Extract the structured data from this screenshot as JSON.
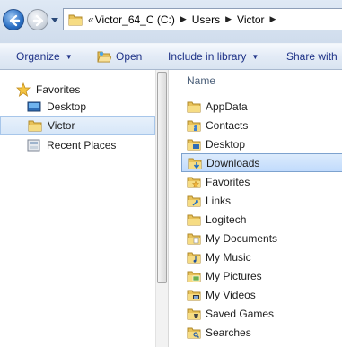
{
  "address": {
    "overflow_chevron": "«",
    "crumbs": [
      "Victor_64_C (C:)",
      "Users",
      "Victor"
    ]
  },
  "toolbar": {
    "organize_label": "Organize",
    "open_label": "Open",
    "include_label": "Include in library",
    "share_label": "Share with"
  },
  "nav": {
    "favorites_label": "Favorites",
    "desktop_label": "Desktop",
    "victor_label": "Victor",
    "recent_label": "Recent Places"
  },
  "files": {
    "column_name": "Name",
    "items": [
      {
        "label": "AppData",
        "icon": "folder-icon"
      },
      {
        "label": "Contacts",
        "icon": "contacts-folder-icon"
      },
      {
        "label": "Desktop",
        "icon": "desktop-folder-icon"
      },
      {
        "label": "Downloads",
        "icon": "downloads-folder-icon"
      },
      {
        "label": "Favorites",
        "icon": "favorites-folder-icon"
      },
      {
        "label": "Links",
        "icon": "links-folder-icon"
      },
      {
        "label": "Logitech",
        "icon": "folder-icon"
      },
      {
        "label": "My Documents",
        "icon": "documents-folder-icon"
      },
      {
        "label": "My Music",
        "icon": "music-folder-icon"
      },
      {
        "label": "My Pictures",
        "icon": "pictures-folder-icon"
      },
      {
        "label": "My Videos",
        "icon": "videos-folder-icon"
      },
      {
        "label": "Saved Games",
        "icon": "saved-games-folder-icon"
      },
      {
        "label": "Searches",
        "icon": "searches-folder-icon"
      }
    ],
    "selected_index": 3
  },
  "colors": {
    "toolbar_text": "#1e3287",
    "header_text": "#4c607a",
    "selection_border": "#7da2ce",
    "folder_yellow": "#f2cf5b"
  }
}
